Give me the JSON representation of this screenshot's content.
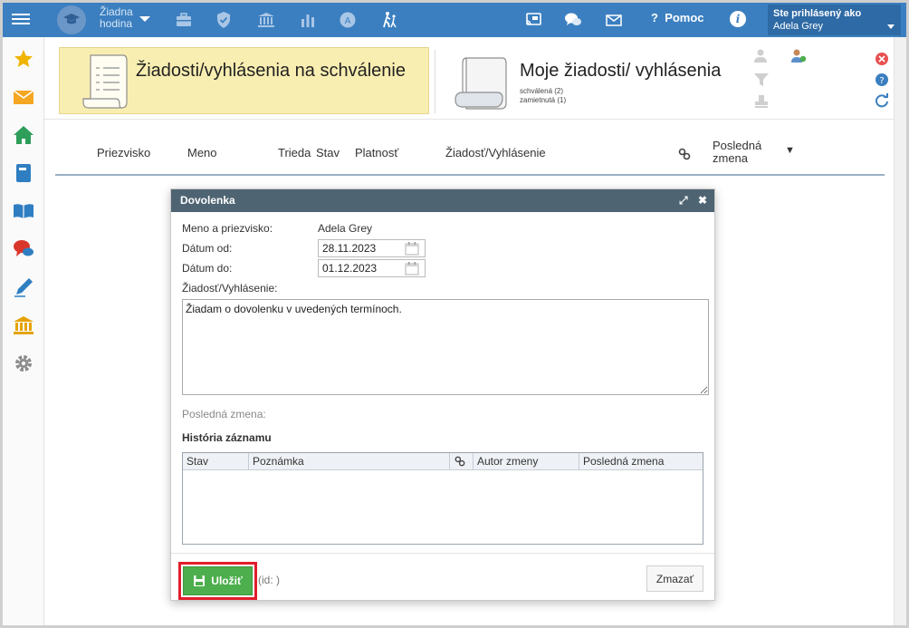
{
  "topbar": {
    "hour_label": "Žiadna hodina",
    "help_label": "Pomoc",
    "info_label": "i",
    "user_prefix": "Ste prihlásený ako",
    "user_name": "Adela Grey"
  },
  "sidebar": {
    "icons": [
      "star-icon",
      "mail-icon",
      "home-icon",
      "book-icon",
      "open-book-icon",
      "chat-icon",
      "pen-icon",
      "bank-icon",
      "gear-icon"
    ]
  },
  "header": {
    "main_title": "Žiadosti/vyhlásenia na schválenie",
    "other_title": "Moje žiadosti/ vyhlásenia",
    "other_sub_1": "schválená (2)",
    "other_sub_2": "zamietnutá (1)"
  },
  "grid": {
    "columns": [
      "Priezvisko",
      "Meno",
      "Trieda",
      "Stav",
      "Platnosť",
      "Žiadosť/Vyhlásenie",
      "Posledná zmena"
    ],
    "sort_indicator": "▼"
  },
  "dialog": {
    "title": "Dovolenka",
    "name_label": "Meno a priezvisko:",
    "name_value": "Adela Grey",
    "date_from_label": "Dátum od:",
    "date_from_value": "28.11.2023",
    "date_to_label": "Dátum do:",
    "date_to_value": "01.12.2023",
    "request_label": "Žiadosť/Vyhlásenie:",
    "request_text": "Žiadam o dovolenku v uvedených termínoch.",
    "last_change_label": "Posledná zmena:",
    "history_title": "História záznamu",
    "history_columns": [
      "Stav",
      "Poznámka",
      "Autor zmeny",
      "Posledná zmena"
    ],
    "save_label": "Uložiť",
    "id_text": "(id: )",
    "delete_label": "Zmazať"
  },
  "colors": {
    "topbar": "#3b7fc0",
    "highlight_card": "#f9eeb1",
    "dialog_header": "#4e6472",
    "save_button": "#4cae4c",
    "save_outline": "#e11d2b"
  }
}
